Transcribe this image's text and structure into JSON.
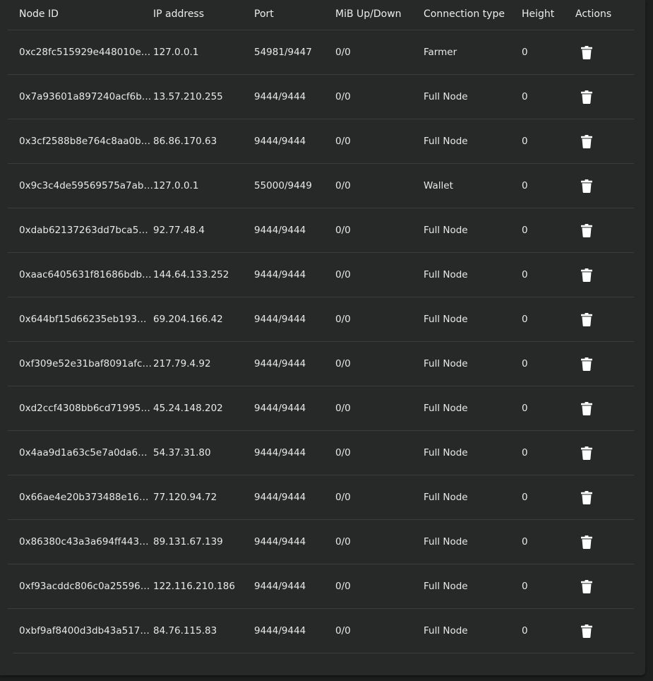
{
  "table": {
    "headers": {
      "node_id": "Node ID",
      "ip_address": "IP address",
      "port": "Port",
      "mib": "MiB Up/Down",
      "connection_type": "Connection type",
      "height": "Height",
      "actions": "Actions"
    },
    "rows": [
      {
        "node_id": "0xc28fc515929e448010e…",
        "ip": "127.0.0.1",
        "port": "54981/9447",
        "mib": "0/0",
        "type": "Farmer",
        "height": "0",
        "action_icon": "trash-icon"
      },
      {
        "node_id": "0x7a93601a897240acf6b…",
        "ip": "13.57.210.255",
        "port": "9444/9444",
        "mib": "0/0",
        "type": "Full Node",
        "height": "0",
        "action_icon": "trash-icon"
      },
      {
        "node_id": "0x3cf2588b8e764c8aa0b…",
        "ip": "86.86.170.63",
        "port": "9444/9444",
        "mib": "0/0",
        "type": "Full Node",
        "height": "0",
        "action_icon": "trash-icon"
      },
      {
        "node_id": "0x9c3c4de59569575a7ab…",
        "ip": "127.0.0.1",
        "port": "55000/9449",
        "mib": "0/0",
        "type": "Wallet",
        "height": "0",
        "action_icon": "trash-icon"
      },
      {
        "node_id": "0xdab62137263dd7bca5…",
        "ip": "92.77.48.4",
        "port": "9444/9444",
        "mib": "0/0",
        "type": "Full Node",
        "height": "0",
        "action_icon": "trash-icon"
      },
      {
        "node_id": "0xaac6405631f81686bdb…",
        "ip": "144.64.133.252",
        "port": "9444/9444",
        "mib": "0/0",
        "type": "Full Node",
        "height": "0",
        "action_icon": "trash-icon"
      },
      {
        "node_id": "0x644bf15d66235eb193…",
        "ip": "69.204.166.42",
        "port": "9444/9444",
        "mib": "0/0",
        "type": "Full Node",
        "height": "0",
        "action_icon": "trash-icon"
      },
      {
        "node_id": "0xf309e52e31baf8091afc…",
        "ip": "217.79.4.92",
        "port": "9444/9444",
        "mib": "0/0",
        "type": "Full Node",
        "height": "0",
        "action_icon": "trash-icon"
      },
      {
        "node_id": "0xd2ccf4308bb6cd71995…",
        "ip": "45.24.148.202",
        "port": "9444/9444",
        "mib": "0/0",
        "type": "Full Node",
        "height": "0",
        "action_icon": "trash-icon"
      },
      {
        "node_id": "0x4aa9d1a63c5e7a0da68…",
        "ip": "54.37.31.80",
        "port": "9444/9444",
        "mib": "0/0",
        "type": "Full Node",
        "height": "0",
        "action_icon": "trash-icon"
      },
      {
        "node_id": "0x66ae4e20b373488e16…",
        "ip": "77.120.94.72",
        "port": "9444/9444",
        "mib": "0/0",
        "type": "Full Node",
        "height": "0",
        "action_icon": "trash-icon"
      },
      {
        "node_id": "0x86380c43a3a694ff443…",
        "ip": "89.131.67.139",
        "port": "9444/9444",
        "mib": "0/0",
        "type": "Full Node",
        "height": "0",
        "action_icon": "trash-icon"
      },
      {
        "node_id": "0xf93acddc806c0a25596…",
        "ip": "122.116.210.186",
        "port": "9444/9444",
        "mib": "0/0",
        "type": "Full Node",
        "height": "0",
        "action_icon": "trash-icon"
      },
      {
        "node_id": "0xbf9af8400d3db43a517…",
        "ip": "84.76.115.83",
        "port": "9444/9444",
        "mib": "0/0",
        "type": "Full Node",
        "height": "0",
        "action_icon": "trash-icon"
      }
    ]
  },
  "colors": {
    "page_background": "#1d1e1e",
    "card_background": "#272828",
    "row_divider": "#3b3c3c",
    "text": "#e8e8e8",
    "icon": "#ffffff"
  }
}
